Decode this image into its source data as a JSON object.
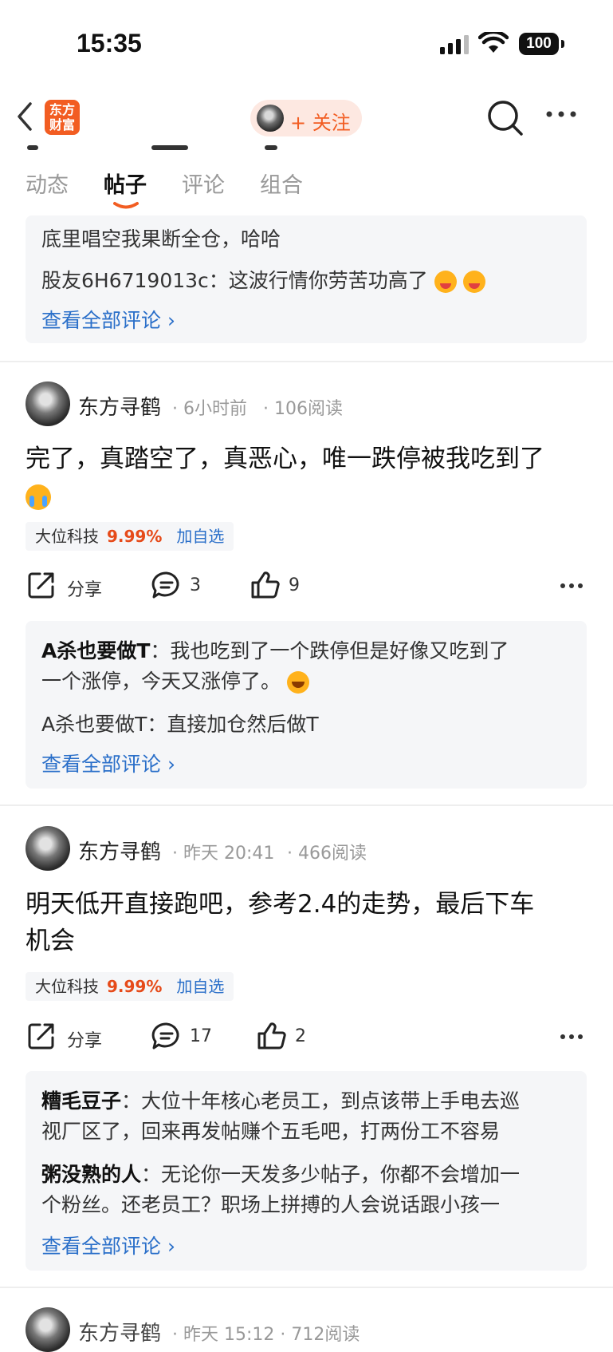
{
  "status": {
    "time": "15:35",
    "battery": "100"
  },
  "nav": {
    "logo_line1": "东方",
    "logo_line2": "财富",
    "follow_label": "+ 关注"
  },
  "tabs": [
    "动态",
    "帖子",
    "评论",
    "组合"
  ],
  "prev_card": {
    "line1": "底里唱空我果断全仓，哈哈",
    "line2_user": "股友6H6719013c",
    "line2_text": "：这波行情你劳苦功高了",
    "view_all": "查看全部评论"
  },
  "posts": [
    {
      "author": "东方寻鹤",
      "time": "· 6小时前",
      "reads": "· 106阅读",
      "text": "完了，真踏空了，真恶心，唯一跌停被我吃到了",
      "stock_name": "大位科技",
      "stock_pct": "9.99%",
      "stock_add": "加自选",
      "share": "分享",
      "comments": "3",
      "likes": "9",
      "c1_user": "A杀也要做T",
      "c1_text_a": "：我也吃到了一个跌停但是好像又吃到了",
      "c1_text_b": "一个涨停，今天又涨停了。",
      "c2_user": "A杀也要做T",
      "c2_text": "：直接加仓然后做T",
      "view_all": "查看全部评论"
    },
    {
      "author": "东方寻鹤",
      "time": "· 昨天 20:41",
      "reads": "· 466阅读",
      "text_a": "明天低开直接跑吧，参考2.4的走势，最后下车",
      "text_b": "机会",
      "stock_name": "大位科技",
      "stock_pct": "9.99%",
      "stock_add": "加自选",
      "share": "分享",
      "comments": "17",
      "likes": "2",
      "c1_user": "糟毛豆子",
      "c1_text_a": "：大位十年核心老员工，到点该带上手电去巡",
      "c1_text_b": "视厂区了，回来再发帖赚个五毛吧，打两份工不容易",
      "c2_user": "粥没熟的人",
      "c2_text_a": "：无论你一天发多少帖子，你都不会增加一",
      "c2_text_b": "个粉丝。还老员工？职场上拼搏的人会说话跟小孩一",
      "view_all": "查看全部评论"
    }
  ],
  "partial_next": {
    "author": "东方寻鹤",
    "meta": "· 昨天 15:12 · 712阅读"
  }
}
